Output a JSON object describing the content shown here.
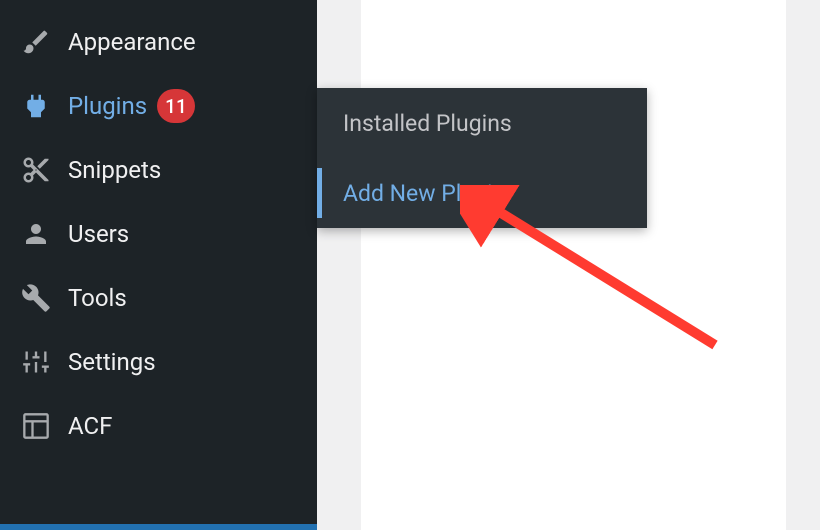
{
  "sidebar": {
    "items": [
      {
        "label": "Appearance",
        "icon": "brush-icon"
      },
      {
        "label": "Plugins",
        "icon": "plug-icon",
        "badge": "11",
        "active": true
      },
      {
        "label": "Snippets",
        "icon": "scissors-icon"
      },
      {
        "label": "Users",
        "icon": "user-icon"
      },
      {
        "label": "Tools",
        "icon": "wrench-icon"
      },
      {
        "label": "Settings",
        "icon": "sliders-icon"
      },
      {
        "label": "ACF",
        "icon": "grid-icon"
      }
    ]
  },
  "flyout": {
    "items": [
      {
        "label": "Installed Plugins"
      },
      {
        "label": "Add New Plugin",
        "active": true
      }
    ]
  },
  "annotation": {
    "arrow_color": "#ff3b30"
  }
}
